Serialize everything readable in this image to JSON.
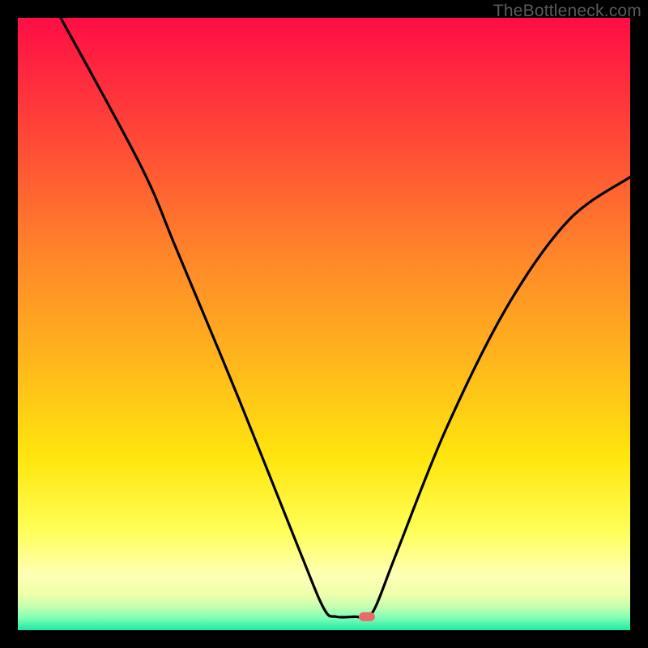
{
  "watermark": "TheBottleneck.com",
  "colors": {
    "frame": "#000000",
    "curve": "#000000",
    "marker": "#e96a66",
    "gradient_stops": [
      {
        "offset": 0,
        "color": "#ff0d46"
      },
      {
        "offset": 18,
        "color": "#ff4338"
      },
      {
        "offset": 38,
        "color": "#ff832a"
      },
      {
        "offset": 55,
        "color": "#ffb31d"
      },
      {
        "offset": 72,
        "color": "#ffe60d"
      },
      {
        "offset": 84,
        "color": "#ffff5a"
      },
      {
        "offset": 91,
        "color": "#ffffb5"
      },
      {
        "offset": 94,
        "color": "#f0ffab"
      },
      {
        "offset": 96,
        "color": "#c9ffb0"
      },
      {
        "offset": 98,
        "color": "#7fffb5"
      },
      {
        "offset": 100,
        "color": "#1de9a4"
      }
    ]
  },
  "chart_data": {
    "type": "line",
    "title": "",
    "xlabel": "",
    "ylabel": "",
    "xlim": [
      0,
      100
    ],
    "ylim": [
      0,
      100
    ],
    "series": [
      {
        "name": "curve",
        "points": [
          {
            "x": 7,
            "y": 100
          },
          {
            "x": 20,
            "y": 76
          },
          {
            "x": 26,
            "y": 62
          },
          {
            "x": 36,
            "y": 38
          },
          {
            "x": 46,
            "y": 13
          },
          {
            "x": 50,
            "y": 3.5
          },
          {
            "x": 52,
            "y": 2.2
          },
          {
            "x": 55,
            "y": 2.2
          },
          {
            "x": 57,
            "y": 2.2
          },
          {
            "x": 58.5,
            "y": 4
          },
          {
            "x": 62,
            "y": 13
          },
          {
            "x": 70,
            "y": 33
          },
          {
            "x": 80,
            "y": 53
          },
          {
            "x": 90,
            "y": 67
          },
          {
            "x": 100,
            "y": 74
          }
        ]
      }
    ],
    "marker": {
      "x": 57,
      "y": 2.2
    }
  }
}
